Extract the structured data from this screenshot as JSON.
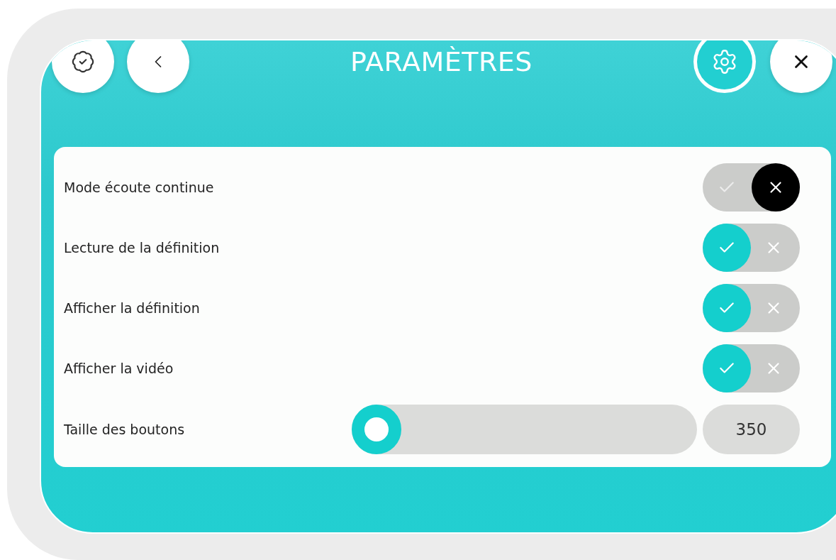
{
  "header": {
    "title": "PARAMÈTRES"
  },
  "settings": [
    {
      "kind": "toggle",
      "label": "Mode écoute continue",
      "on": false
    },
    {
      "kind": "toggle",
      "label": "Lecture de la définition",
      "on": true
    },
    {
      "kind": "toggle",
      "label": "Afficher la définition",
      "on": true
    },
    {
      "kind": "toggle",
      "label": "Afficher la vidéo",
      "on": true
    },
    {
      "kind": "slider",
      "label": "Taille des boutons",
      "level": 0,
      "value": "350"
    }
  ]
}
